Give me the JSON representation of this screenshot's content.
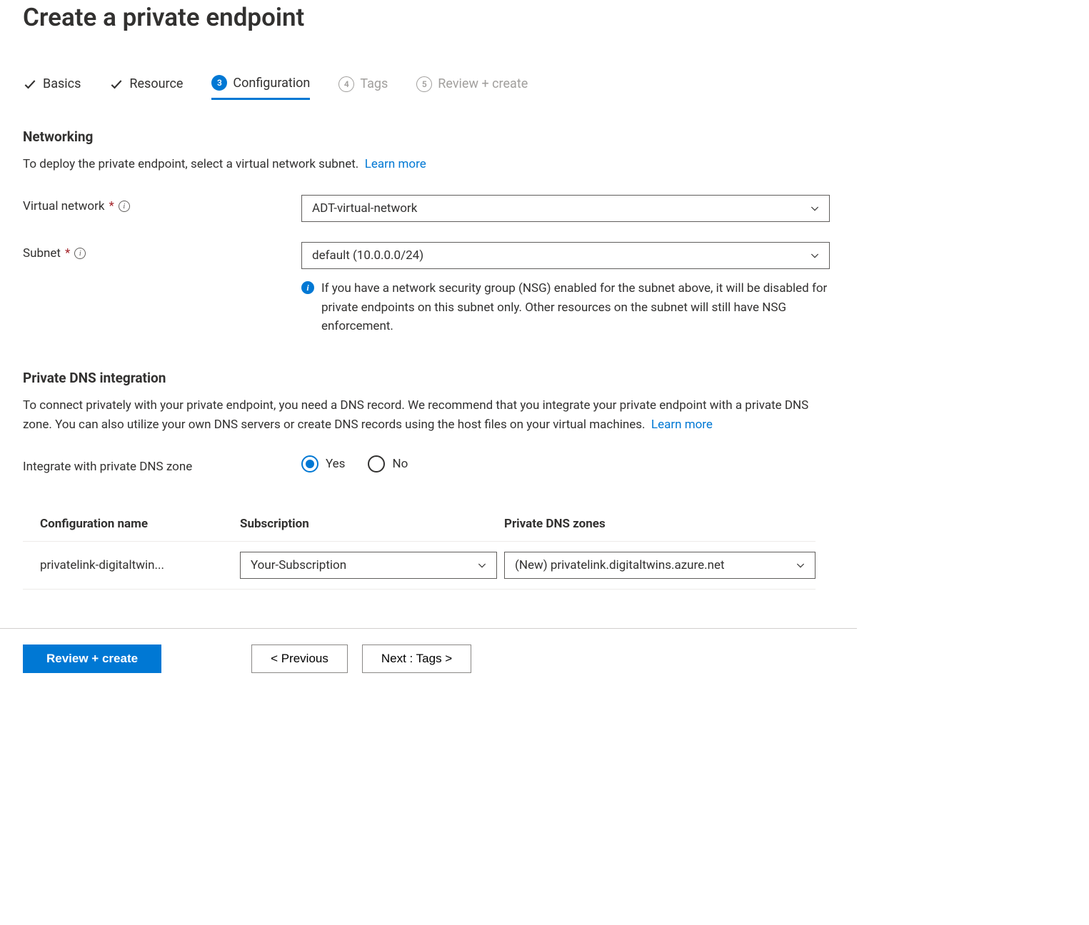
{
  "page_title": "Create a private endpoint",
  "steps": {
    "basics": {
      "label": "Basics"
    },
    "resource": {
      "label": "Resource"
    },
    "configuration": {
      "number": "3",
      "label": "Configuration"
    },
    "tags": {
      "number": "4",
      "label": "Tags"
    },
    "review": {
      "number": "5",
      "label": "Review + create"
    }
  },
  "networking": {
    "heading": "Networking",
    "description": "To deploy the private endpoint, select a virtual network subnet.",
    "learn_more": "Learn more",
    "virtual_network_label": "Virtual network",
    "virtual_network_value": "ADT-virtual-network",
    "subnet_label": "Subnet",
    "subnet_value": "default (10.0.0.0/24)",
    "subnet_note": "If you have a network security group (NSG) enabled for the subnet above, it will be disabled for private endpoints on this subnet only. Other resources on the subnet will still have NSG enforcement."
  },
  "dns": {
    "heading": "Private DNS integration",
    "description": "To connect privately with your private endpoint, you need a DNS record. We recommend that you integrate your private endpoint with a private DNS zone. You can also utilize your own DNS servers or create DNS records using the host files on your virtual machines.",
    "learn_more": "Learn more",
    "integrate_label": "Integrate with private DNS zone",
    "yes_label": "Yes",
    "no_label": "No",
    "table": {
      "col_config": "Configuration name",
      "col_sub": "Subscription",
      "col_zone": "Private DNS zones",
      "row": {
        "config_name": "privatelink-digitaltwin...",
        "subscription": "Your-Subscription",
        "zone": "(New) privatelink.digitaltwins.azure.net"
      }
    }
  },
  "footer": {
    "review_create": "Review + create",
    "previous": "< Previous",
    "next": "Next : Tags >"
  }
}
